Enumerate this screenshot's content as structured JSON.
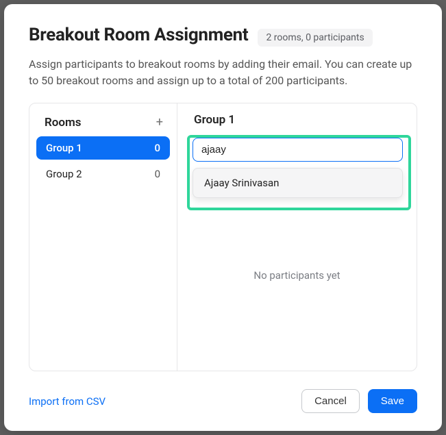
{
  "heading": "Breakout Room Assignment",
  "badge": "2 rooms, 0 participants",
  "description": "Assign participants to breakout rooms by adding their email. You can create up to 50 breakout rooms and assign up to a total of 200 participants.",
  "rooms_label": "Rooms",
  "rooms": [
    {
      "name": "Group 1",
      "count": "0",
      "selected": true
    },
    {
      "name": "Group 2",
      "count": "0",
      "selected": false
    }
  ],
  "current_room_title": "Group 1",
  "search_value": "ajaay",
  "suggestions": [
    {
      "label": "Ajaay Srinivasan"
    }
  ],
  "no_participants_text": "No participants yet",
  "import_link": "Import from CSV",
  "cancel_label": "Cancel",
  "save_label": "Save",
  "add_room_glyph": "+"
}
